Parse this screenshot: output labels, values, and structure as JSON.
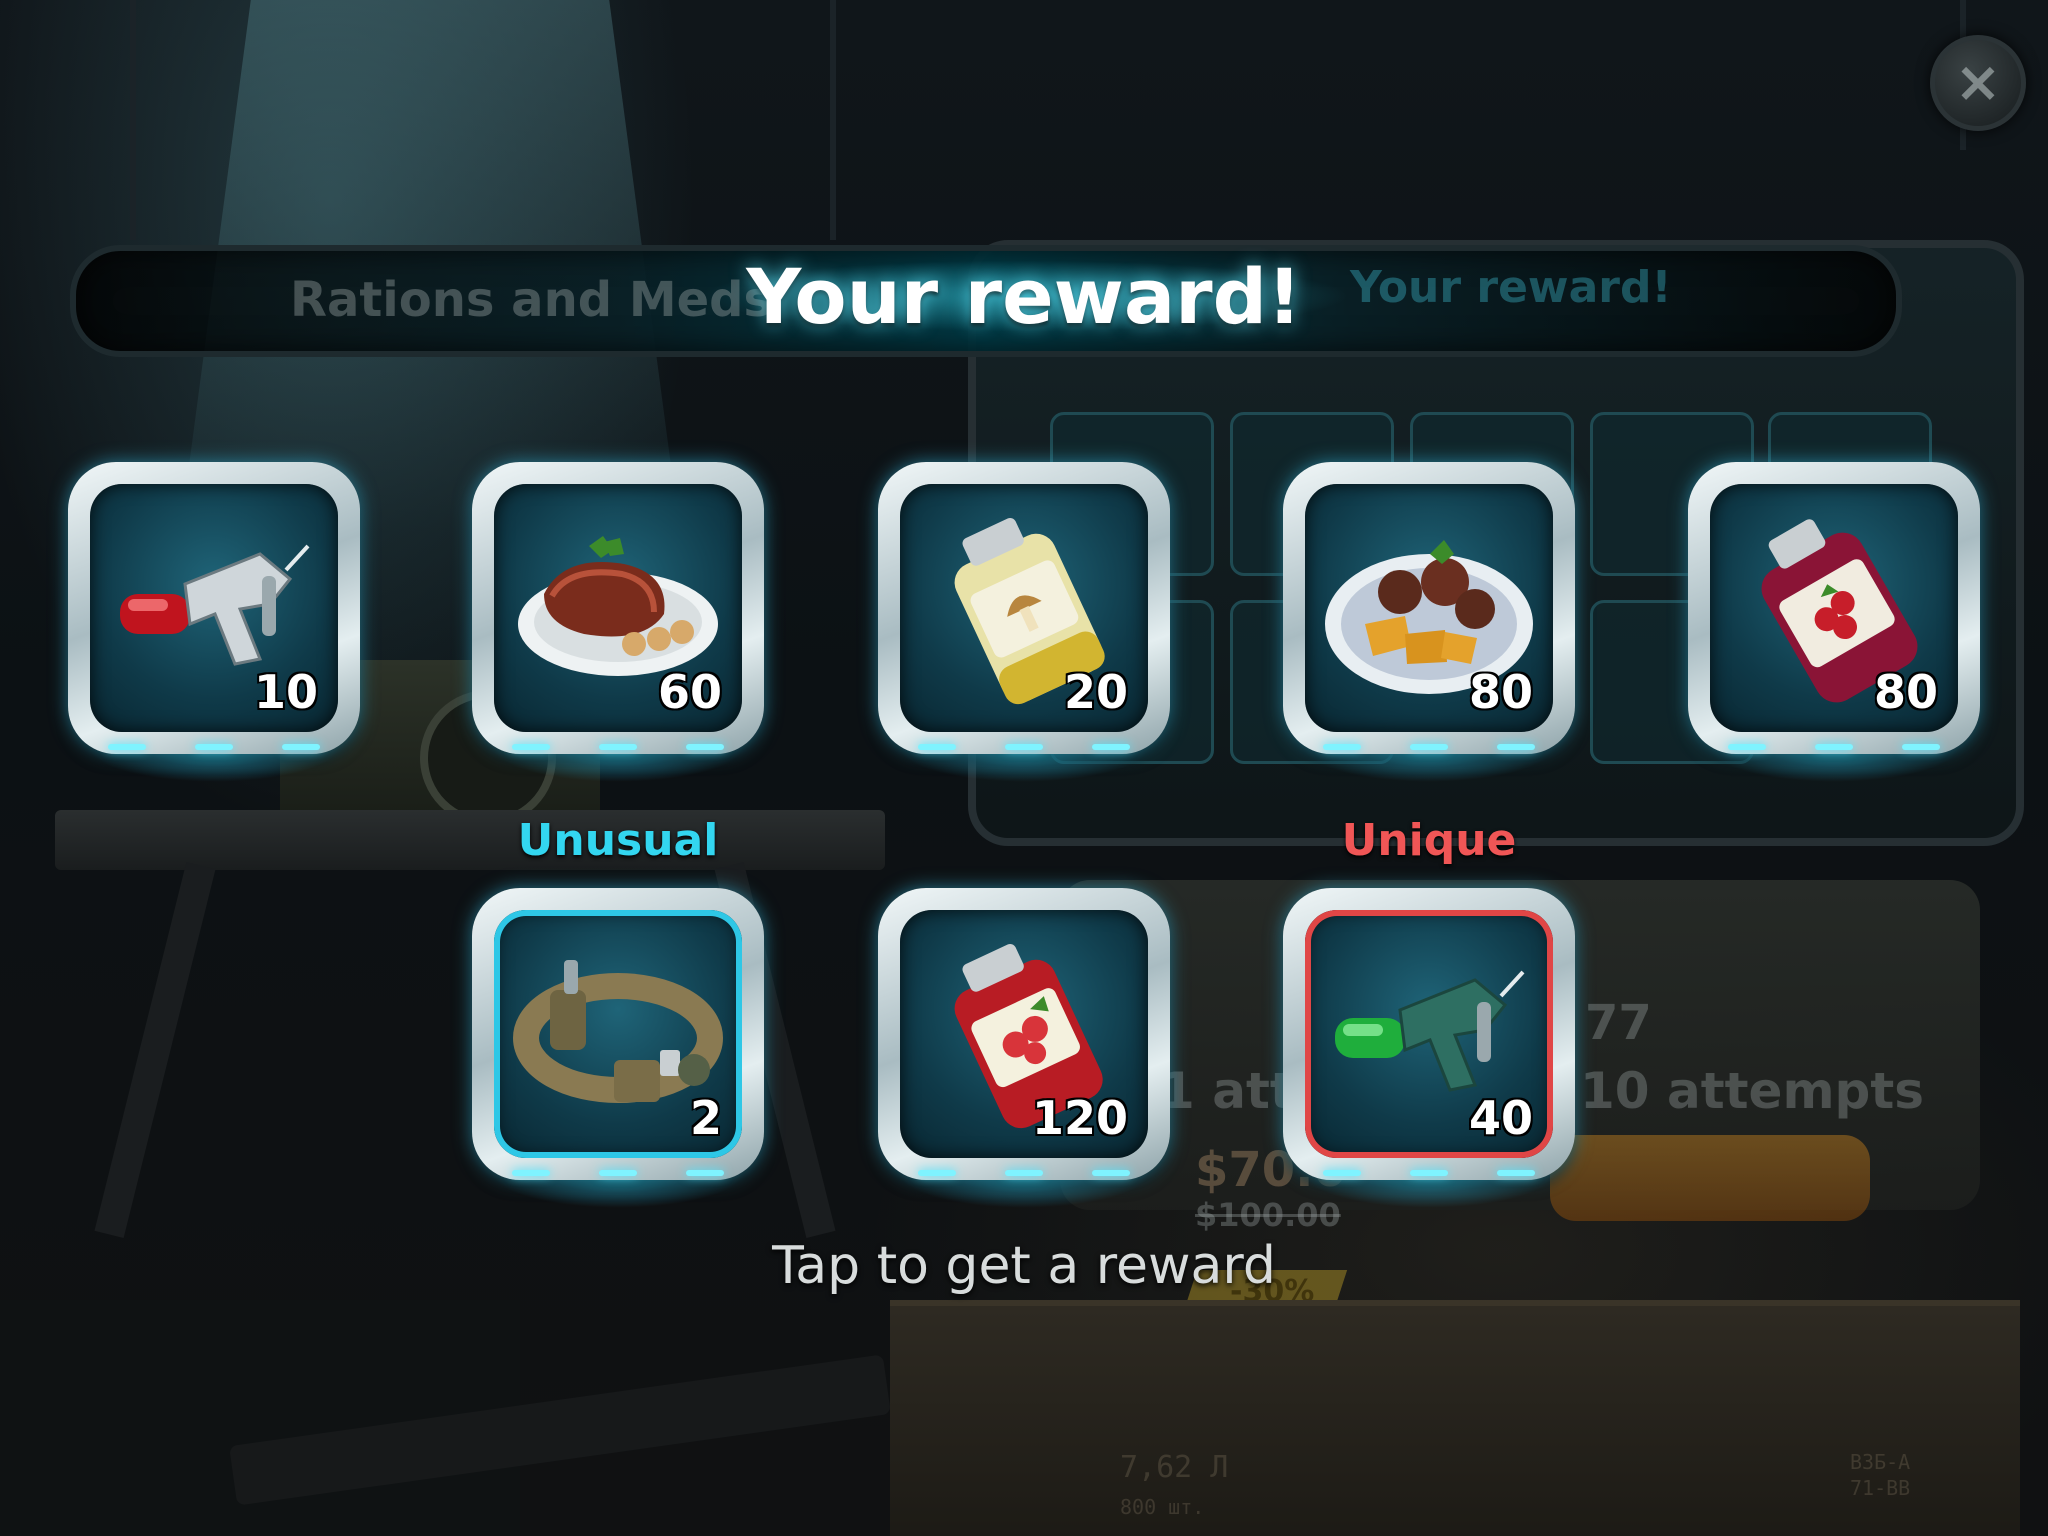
{
  "title": "Your reward!",
  "tabs": {
    "left": "Rations and Meds",
    "right": "Your reward!"
  },
  "close_icon": "close-icon",
  "rewards": [
    {
      "icon": "red-injector-icon",
      "count": "10",
      "rarity": ""
    },
    {
      "icon": "steak-plate-icon",
      "count": "60",
      "rarity": ""
    },
    {
      "icon": "mushroom-jar-icon",
      "count": "20",
      "rarity": ""
    },
    {
      "icon": "meat-potato-plate-icon",
      "count": "80",
      "rarity": ""
    },
    {
      "icon": "berry-bottle-icon",
      "count": "80",
      "rarity": ""
    },
    {
      "icon": "utility-belt-icon",
      "count": "2",
      "rarity": "Unusual"
    },
    {
      "icon": "red-berry-jar-icon",
      "count": "120",
      "rarity": ""
    },
    {
      "icon": "green-injector-icon",
      "count": "40",
      "rarity": "Unique"
    }
  ],
  "rarity_colors": {
    "Unusual": "#33d6f0",
    "Unique": "#f05656"
  },
  "hint": "Tap to get a reward",
  "background_shop": {
    "attempts_left_fragment": "1 atte",
    "attempts": "10 attempts",
    "price": "$70.0",
    "old_price": "$100.00",
    "discount": "-30%",
    "counter": "77",
    "crate_stencil": "7,62 Л",
    "crate_code": "ВЗБ-А",
    "crate_sub": "71-ВВ",
    "crate_qty": "800 шт."
  },
  "colors": {
    "accent": "#4ee6ff",
    "title_glow": "#5adcf0"
  }
}
